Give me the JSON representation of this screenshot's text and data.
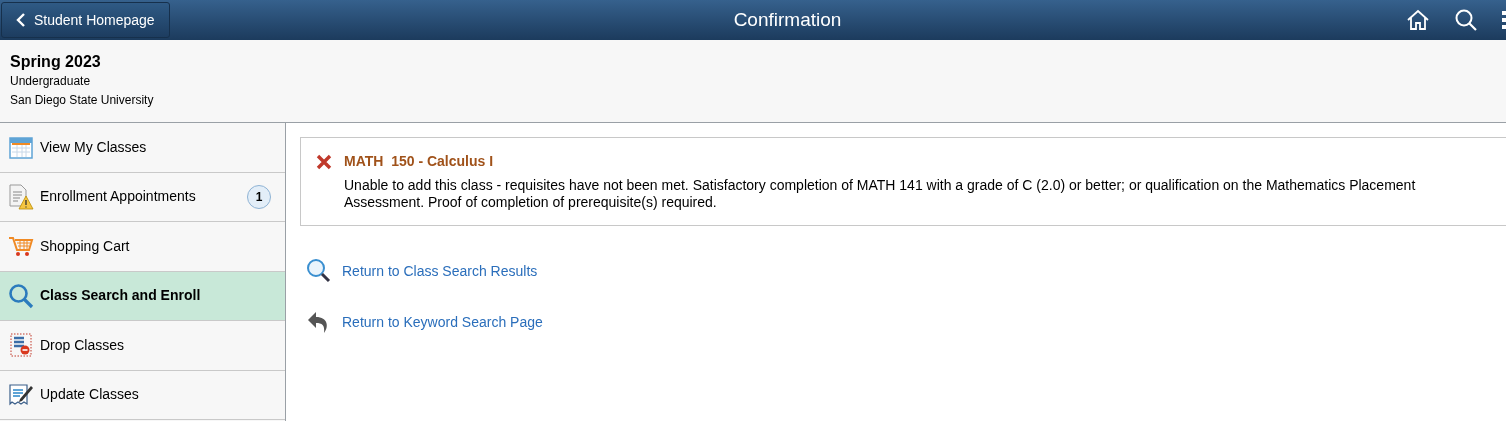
{
  "header": {
    "back_button": "Student Homepage",
    "title": "Confirmation"
  },
  "context": {
    "term": "Spring 2023",
    "career": "Undergraduate",
    "institution": "San Diego State University"
  },
  "sidebar": {
    "items": [
      {
        "label": "View My Classes",
        "kind": "calendar",
        "selected": false
      },
      {
        "label": "Enrollment Appointments",
        "kind": "appointments",
        "selected": false,
        "badge": "1"
      },
      {
        "label": "Shopping Cart",
        "kind": "cart",
        "selected": false
      },
      {
        "label": "Class Search and Enroll",
        "kind": "search",
        "selected": true
      },
      {
        "label": "Drop Classes",
        "kind": "drop",
        "selected": false
      },
      {
        "label": "Update Classes",
        "kind": "update",
        "selected": false
      }
    ]
  },
  "message": {
    "kind": "error",
    "title": "MATH  150 - Calculus I",
    "text": "Unable to add this class - requisites have not been met. Satisfactory completion of MATH 141 with a grade of C (2.0) or better; or qualification on the Mathematics Placement Assessment. Proof of completion of prerequisite(s) required."
  },
  "links": [
    {
      "label": "Return to Class Search Results",
      "kind": "search"
    },
    {
      "label": "Return to Keyword Search Page",
      "kind": "return"
    }
  ]
}
